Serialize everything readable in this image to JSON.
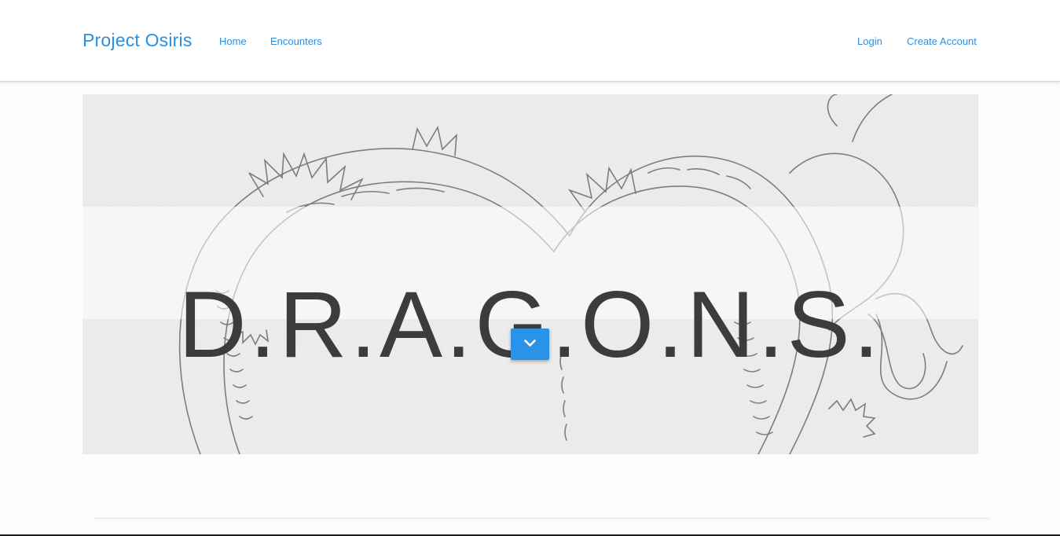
{
  "navbar": {
    "brand": "Project Osiris",
    "links": {
      "home": "Home",
      "encounters": "Encounters",
      "login": "Login",
      "create_account": "Create Account"
    }
  },
  "hero": {
    "title": "D.R.A.G.O.N.S.",
    "background_image": "dragon-sketch",
    "scroll_button_icon": "chevron-down-icon"
  },
  "colors": {
    "accent": "#2b8fe0",
    "button": "#2a93e8",
    "title_text": "#3c3c3c",
    "page_background": "#fcfcfc"
  }
}
